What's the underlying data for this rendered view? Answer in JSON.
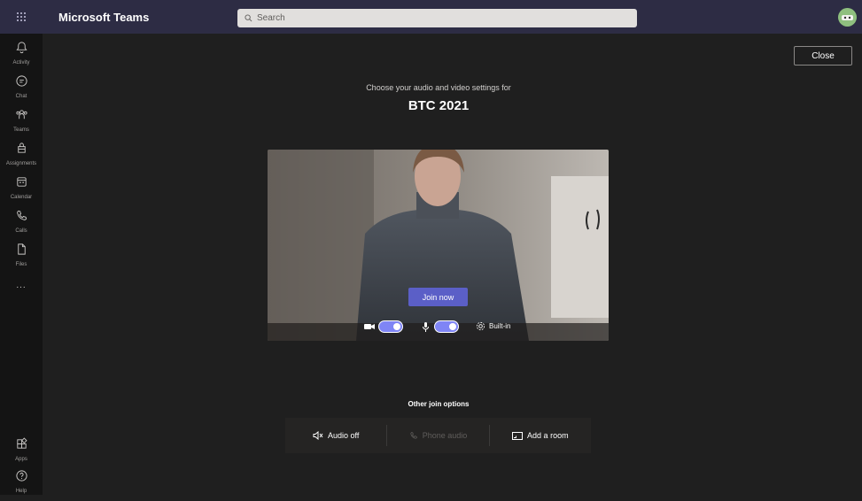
{
  "app": {
    "name": "Microsoft Teams"
  },
  "search": {
    "placeholder": "Search"
  },
  "rail": {
    "items": [
      {
        "label": "Activity",
        "icon": "bell-icon"
      },
      {
        "label": "Chat",
        "icon": "chat-icon"
      },
      {
        "label": "Teams",
        "icon": "teams-icon"
      },
      {
        "label": "Assignments",
        "icon": "assignments-icon"
      },
      {
        "label": "Calendar",
        "icon": "calendar-icon"
      },
      {
        "label": "Calls",
        "icon": "phone-icon"
      },
      {
        "label": "Files",
        "icon": "file-icon"
      }
    ],
    "more": "...",
    "bottom": [
      {
        "label": "Apps",
        "icon": "apps-icon"
      },
      {
        "label": "Help",
        "icon": "help-icon"
      }
    ]
  },
  "prejoin": {
    "close_label": "Close",
    "subtitle": "Choose your audio and video settings for",
    "meeting_title": "BTC 2021",
    "join_label": "Join now",
    "camera_on": true,
    "mic_on": true,
    "device_label": "Built-in",
    "other_options_title": "Other join options",
    "options": [
      {
        "label": "Audio off",
        "icon": "speaker-off-icon",
        "enabled": true
      },
      {
        "label": "Phone audio",
        "icon": "phone-icon",
        "enabled": false
      },
      {
        "label": "Add a room",
        "icon": "cast-icon",
        "enabled": true
      }
    ]
  },
  "colors": {
    "topbar": "#2d2c44",
    "accent": "#5b5fc7",
    "toggle": "#7f85f5",
    "background": "#1f1f1f"
  }
}
